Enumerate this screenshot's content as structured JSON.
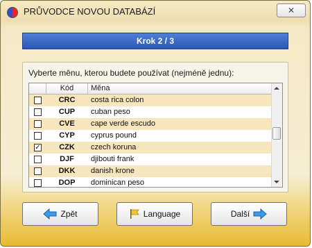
{
  "window": {
    "title": "PRŮVODCE NOVOU DATABÁZÍ",
    "close_label": "✕"
  },
  "step": {
    "label": "Krok 2 / 3"
  },
  "instruction": "Vyberte měnu, kterou budete používat (nejméně jednu):",
  "table": {
    "columns": [
      "Kód",
      "Měna"
    ],
    "rows": [
      {
        "code": "CRC",
        "name": "costa rica colon",
        "checked": false
      },
      {
        "code": "CUP",
        "name": "cuban peso",
        "checked": false
      },
      {
        "code": "CVE",
        "name": "cape verde escudo",
        "checked": false
      },
      {
        "code": "CYP",
        "name": "cyprus pound",
        "checked": false
      },
      {
        "code": "CZK",
        "name": "czech koruna",
        "checked": true
      },
      {
        "code": "DJF",
        "name": "djibouti frank",
        "checked": false
      },
      {
        "code": "DKK",
        "name": "danish krone",
        "checked": false
      },
      {
        "code": "DOP",
        "name": "dominican peso",
        "checked": false
      }
    ]
  },
  "buttons": {
    "back": "Zpět",
    "language": "Language",
    "next": "Další"
  },
  "colors": {
    "header_blue": "#2c58b4",
    "row_alt": "#f7e6bd",
    "bottom_gold": "#e8b830"
  },
  "icons": {
    "back": "arrow-left-icon",
    "language": "flag-icon",
    "next": "arrow-right-icon"
  }
}
